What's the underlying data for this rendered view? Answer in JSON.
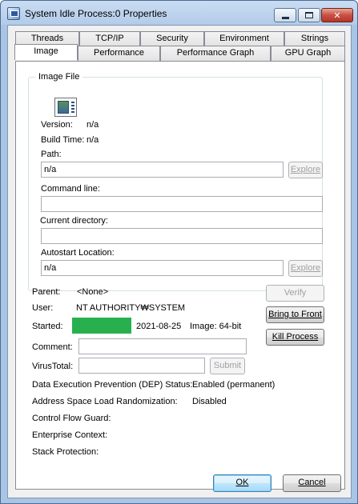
{
  "window": {
    "title": "System Idle Process:0 Properties",
    "minimize_label": "▭",
    "maximize_label": "▢",
    "close_label": "✕"
  },
  "tabs": {
    "row_back": [
      "Threads",
      "TCP/IP",
      "Security",
      "Environment",
      "Strings"
    ],
    "row_front": [
      "Image",
      "Performance",
      "Performance Graph",
      "GPU Graph"
    ],
    "active": "Image"
  },
  "image_file": {
    "group_title": "Image File",
    "icon": "application-window-icon",
    "version_label": "Version:",
    "version_value": "n/a",
    "build_time_label": "Build Time:",
    "build_time_value": "n/a",
    "path_label": "Path:",
    "path_value": "n/a",
    "explore_label": "Explore",
    "command_line_label": "Command line:",
    "command_line_value": "",
    "current_directory_label": "Current directory:",
    "current_directory_value": "",
    "autostart_label": "Autostart Location:",
    "autostart_value": "n/a"
  },
  "process": {
    "parent_label": "Parent:",
    "parent_value": "<None>",
    "user_label": "User:",
    "user_value": "NT AUTHORITY₩SYSTEM",
    "started_label": "Started:",
    "started_date": "2021-08-25",
    "image_label": "Image: 64-bit",
    "comment_label": "Comment:",
    "comment_value": "",
    "virustotal_label": "VirusTotal:",
    "virustotal_value": "",
    "submit_label": "Submit",
    "dep_label": "Data Execution Prevention (DEP) Status:",
    "dep_value": "Enabled (permanent)",
    "aslr_label": "Address Space Load Randomization:",
    "aslr_value": "Disabled",
    "cfg_label": "Control Flow Guard:",
    "enterprise_label": "Enterprise Context:",
    "stack_label": "Stack Protection:"
  },
  "actions": {
    "verify_label": "Verify",
    "bring_to_front_label": "Bring to Front",
    "kill_process_label": "Kill Process"
  },
  "footer": {
    "ok_label": "OK",
    "cancel_label": "Cancel"
  },
  "colors": {
    "redaction": "#28b04f",
    "titlebar": "#b9cfea"
  }
}
